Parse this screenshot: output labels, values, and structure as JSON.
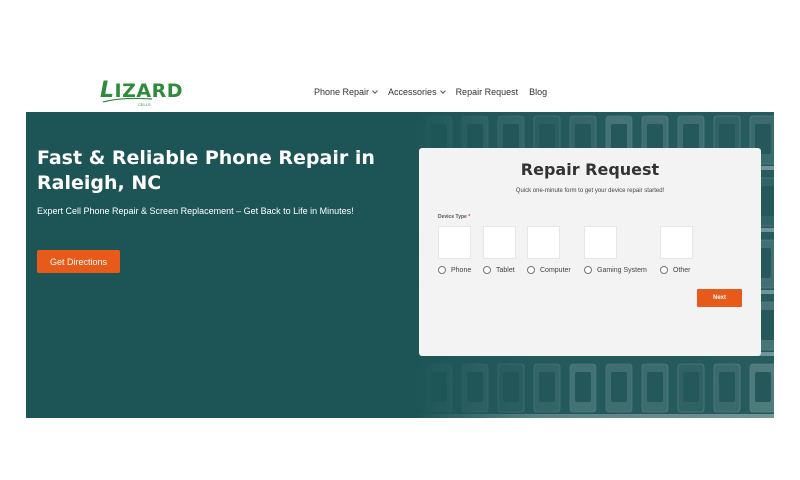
{
  "brand": {
    "logo_text": "LIZARD",
    "logo_sub": "CELLS",
    "color": "#2e8b3c"
  },
  "nav": {
    "items": [
      {
        "label": "Phone Repair",
        "dropdown": true
      },
      {
        "label": "Accessories",
        "dropdown": true
      },
      {
        "label": "Repair Request",
        "dropdown": false
      },
      {
        "label": "Blog",
        "dropdown": false
      }
    ]
  },
  "hero": {
    "title": "Fast & Reliable Phone Repair in Raleigh, NC",
    "subtitle": "Expert Cell Phone Repair & Screen Replacement – Get Back to Life in Minutes!",
    "cta_label": "Get Directions",
    "bg_color": "#1d5557",
    "accent": "#e85a1a"
  },
  "form": {
    "title": "Repair Request",
    "subtitle": "Quick one-minute form to get your device repair started!",
    "field_label": "Device Type",
    "required_mark": "*",
    "options": [
      {
        "label": "Phone"
      },
      {
        "label": "Tablet"
      },
      {
        "label": "Computer"
      },
      {
        "label": "Gaming System"
      },
      {
        "label": "Other"
      }
    ],
    "next_label": "Next"
  }
}
